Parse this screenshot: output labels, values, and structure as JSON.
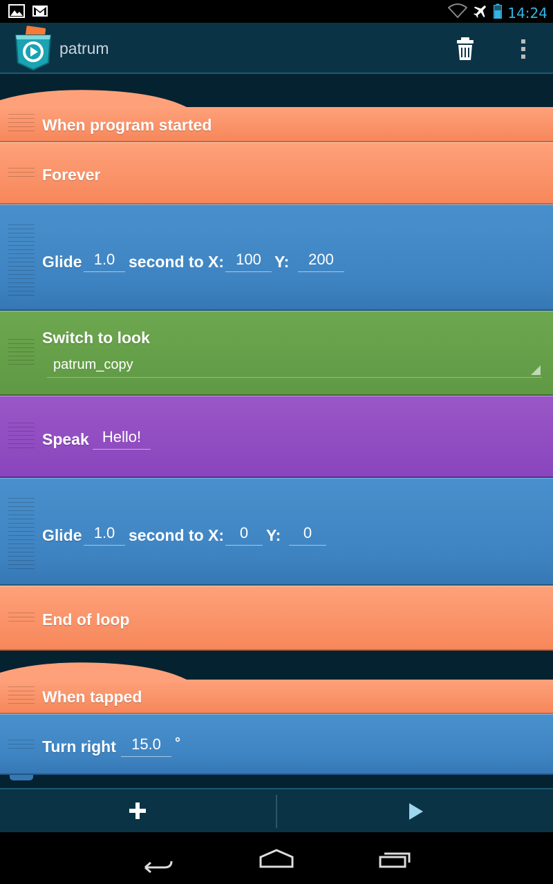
{
  "status_bar": {
    "time": "14:24"
  },
  "action_bar": {
    "title": "patrum"
  },
  "script_one": {
    "hat_label": "When program started",
    "forever_label": "Forever",
    "glide1": {
      "word": "Glide",
      "seconds": "1.0",
      "middle": "second to X:",
      "x": "100",
      "y_word": "Y:",
      "y": "200"
    },
    "look": {
      "label": "Switch to look",
      "value": "patrum_copy"
    },
    "speak": {
      "label": "Speak",
      "text": "Hello!"
    },
    "glide2": {
      "word": "Glide",
      "seconds": "1.0",
      "middle": "second to X:",
      "x": "0",
      "y_word": "Y:",
      "y": "0"
    },
    "end_loop_label": "End of loop"
  },
  "script_two": {
    "hat_label": "When tapped",
    "turn": {
      "label": "Turn right",
      "degrees": "15.0",
      "unit": "°"
    }
  },
  "colors": {
    "control_orange": "#f7875b",
    "motion_blue": "#4189c7",
    "looks_green": "#659f49",
    "sound_purple": "#8d4abf",
    "accent": "#33b5e5"
  }
}
